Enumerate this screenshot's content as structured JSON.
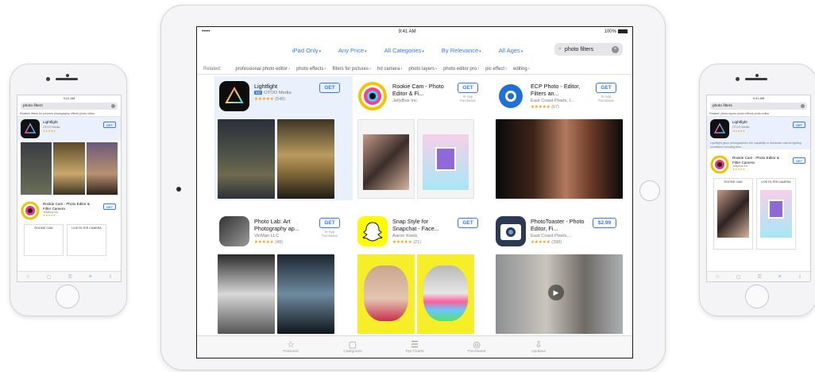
{
  "ipad": {
    "status": {
      "carrier": "•••••",
      "time": "9:41 AM",
      "battery": "100%"
    },
    "filters": [
      {
        "label": "iPad Only",
        "caret": "▾"
      },
      {
        "label": "Any Price",
        "caret": "▾"
      },
      {
        "label": "All Categories",
        "caret": "▾"
      },
      {
        "label": "By Relevance",
        "caret": "▾"
      },
      {
        "label": "All Ages",
        "caret": "▾"
      }
    ],
    "search": {
      "value": "photo filters",
      "icon": "search-icon"
    },
    "related_label": "Related:",
    "related_tags": [
      "professional photo editor",
      "photo effects",
      "filters for pictures",
      "hd camera",
      "photo layers",
      "photo editor pro",
      "pic effect",
      "editing"
    ],
    "apps": [
      {
        "title": "Lightfight",
        "developer": "OTOO Media",
        "badge": "ED",
        "stars": "★★★★★",
        "count": "(548)",
        "button": "GET",
        "iap": ""
      },
      {
        "title": "Rookie Cam - Photo Editor & Fi...",
        "developer": "JellyBus Inc.",
        "stars": "",
        "count": "",
        "button": "GET",
        "iap": "In-App Purchases"
      },
      {
        "title": "ECP Photo - Editor, Filters an...",
        "developer": "East Coast Pixels, I...",
        "stars": "★★★★★",
        "count": "(67)",
        "button": "GET",
        "iap": "In-App Purchases"
      },
      {
        "title": "Photo Lab: Art Photography ap...",
        "developer": "VicMan LLC",
        "stars": "★★★★★",
        "count": "(48)",
        "button": "GET",
        "iap": "In-App Purchases"
      },
      {
        "title": "Snap Style for Snapchat - Face...",
        "developer": "Aaron Kwok",
        "stars": "★★★★★",
        "count": "(21)",
        "button": "GET",
        "iap": ""
      },
      {
        "title": "PhotoToaster - Photo Editor, Fi...",
        "developer": "East Coast Pixels,...",
        "stars": "★★★★★",
        "count": "(398)",
        "button": "$2.99",
        "iap": ""
      }
    ],
    "tabbar": [
      {
        "label": "Featured",
        "icon": "☆"
      },
      {
        "label": "Categories",
        "icon": "▢"
      },
      {
        "label": "Top Charts",
        "icon": "☰"
      },
      {
        "label": "Purchased",
        "icon": "◎"
      },
      {
        "label": "Updates",
        "icon": "⇩"
      }
    ]
  },
  "phone_left": {
    "status": "9:41 AM",
    "search": "photo filters",
    "related": "Related:  filters for pictures  photography effects  photo editor",
    "app1": {
      "title": "Lightfight",
      "developer": "OTOO Media",
      "stars": "★★★★★",
      "button": "GET"
    },
    "app2": {
      "title": "Rookie Cam - Photo Editor & Filter Camera",
      "developer": "JellyBus Inc.",
      "stars": "★★★★★",
      "button": "GET"
    },
    "promo1": "ROOKIE CAM",
    "promo2": "LIVE FILTER CAMERA"
  },
  "phone_right": {
    "status": "9:41 AM",
    "search": "photo filters",
    "related": "Related:  photo layers  photo effects  photo editor",
    "app1": {
      "title": "Lightfight",
      "developer": "OTOO Media",
      "stars": "★★★★★",
      "button": "GET"
    },
    "desc": "Lightfight gives photographers the capability to illuminate natural lighting conditions including time...",
    "app2": {
      "title": "Rookie Cam - Photo Editor & Filter Camera",
      "developer": "JellyBus Inc.",
      "stars": "★★★★★",
      "button": "GET"
    },
    "promo1": "ROOKIE CAM",
    "promo2": "LIVE FILTER CAMERA"
  },
  "colors": {
    "accent": "#2f7bf5",
    "star": "#ff9500",
    "selected_bg": "#eaf1fc"
  }
}
